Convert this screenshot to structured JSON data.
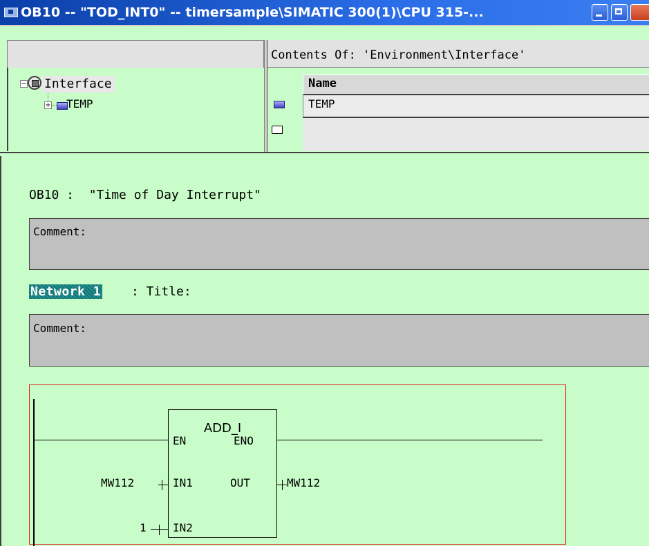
{
  "window": {
    "title": "OB10 -- \"TOD_INT0\" -- timersample\\SIMATIC 300(1)\\CPU 315-..."
  },
  "interface_panel": {
    "contents_label": "Contents Of: 'Environment\\Interface'",
    "tree": {
      "root_label": "Interface",
      "child_label": "TEMP",
      "root_expander": "−",
      "child_expander": "+"
    },
    "list": {
      "column_header": "Name",
      "rows": [
        "TEMP"
      ]
    }
  },
  "editor": {
    "block_title": "OB10 :  \"Time of Day Interrupt\"",
    "block_comment": "Comment:",
    "network": {
      "label": "Network 1",
      "title": ": Title:",
      "comment": "Comment:"
    },
    "ladder": {
      "box_name": "ADD_I",
      "pins": {
        "en": "EN",
        "eno": "ENO",
        "in1": "IN1",
        "in2": "IN2",
        "out": "OUT"
      },
      "operands": {
        "in1": "MW112",
        "in2": "1",
        "out": "MW112"
      }
    }
  },
  "colors": {
    "background": "#c8fcc8",
    "titlebar": "#2a6de8",
    "network_highlight": "#0a7878",
    "network_frame": "#e02020",
    "comment_box": "#c0c0c0"
  }
}
